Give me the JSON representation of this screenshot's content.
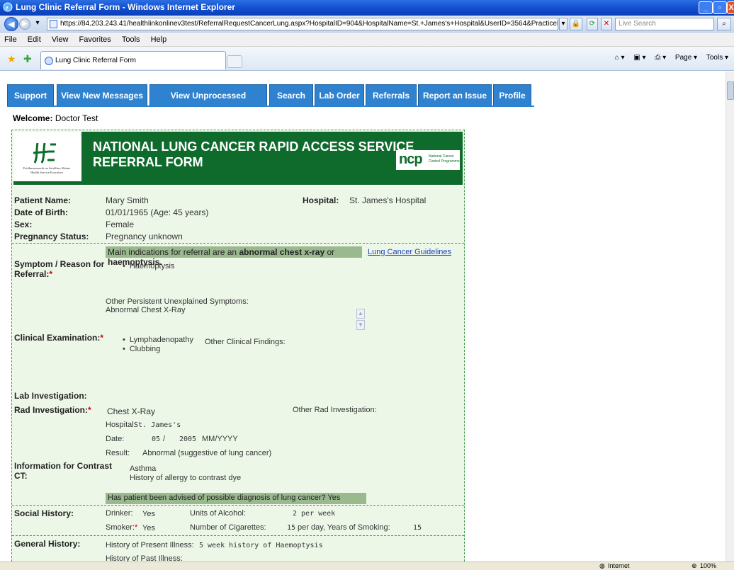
{
  "window": {
    "title": "Lung Clinic Referral Form - Windows Internet Explorer"
  },
  "browser": {
    "url": "https://84.203.243.41/healthlinkonlinev3test/ReferralRequestCancerLung.aspx?HospitalID=904&HospitalName=St.+James's+Hospital&UserID=3564&PracticeEmergencyN",
    "live_search_placeholder": "Live Search",
    "menu": [
      "File",
      "Edit",
      "View",
      "Favorites",
      "Tools",
      "Help"
    ],
    "tab_title": "Lung Clinic Referral Form",
    "commands": [
      "Page ▾",
      "Tools ▾"
    ],
    "status_zone": "Internet",
    "zoom": "100%"
  },
  "nav": [
    "Support",
    "View New Messages",
    "View Unprocessed Messages",
    "Search",
    "Lab Order",
    "Referrals",
    "Report an Issue",
    "Profile"
  ],
  "welcome": {
    "label": "Welcome:",
    "name": "Doctor Test"
  },
  "banner": {
    "title_line1": "NATIONAL LUNG CANCER RAPID ACCESS SERVICE",
    "title_line2": "REFERRAL FORM",
    "hse_text1": "Feidhmeannacht na Seirbhíse Sláinte",
    "hse_text2": "Health Service Executive",
    "ncp_logo": "ncp",
    "ncp_text1": "National Cancer",
    "ncp_text2": "Control Programme"
  },
  "patient": {
    "name_label": "Patient Name:",
    "name": "Mary Smith",
    "hospital_label": "Hospital:",
    "hospital": "St. James's Hospital",
    "dob_label": "Date of Birth:",
    "dob": "01/01/1965 (Age: 45 years)",
    "sex_label": "Sex:",
    "sex": "Female",
    "pregnancy_label": "Pregnancy Status:",
    "pregnancy": "Pregnancy unknown"
  },
  "indication": {
    "prefix": "Main indications for referral are an",
    "bold1": "abnormal chest x-ray",
    "mid": "or",
    "bold2": "haemoptysis.",
    "link": "Lung Cancer Guidelines"
  },
  "symptom": {
    "label_line1": "Symptom / Reason for",
    "label_line2": "Referral:",
    "items": [
      "Haemoptysis"
    ],
    "other_label": "Other Persistent Unexplained Symptoms:",
    "other_value": "Abnormal Chest X-Ray"
  },
  "clinical": {
    "label": "Clinical Examination:",
    "items": [
      "Lymphadenopathy",
      "Clubbing"
    ],
    "other_label": "Other Clinical Findings:"
  },
  "lab": {
    "label": "Lab Investigation:"
  },
  "rad": {
    "label": "Rad Investigation:",
    "type": "Chest X-Ray",
    "other_label": "Other Rad Investigation:",
    "hospital_label": "Hospital:",
    "hospital": "St. James's",
    "date_label": "Date:",
    "month": "05",
    "sep": "/",
    "year": "2005",
    "format": "MM/YYYY",
    "result_label": "Result:",
    "result": "Abnormal (suggestive of lung cancer)"
  },
  "contrast": {
    "label_line1": "Information for Contrast",
    "label_line2": "CT:",
    "items": [
      "Asthma",
      "History of allergy to contrast dye"
    ],
    "advised": "Has patient been advised of possible diagnosis of lung cancer? Yes"
  },
  "social": {
    "label": "Social History:",
    "drinker_label": "Drinker:",
    "drinker": "Yes",
    "alcohol_label": "Units of Alcohol:",
    "alcohol": "2 per week",
    "smoker_label": "Smoker:",
    "smoker": "Yes",
    "cigs_label": "Number of Cigarettes:",
    "cigs": "15",
    "cigs_suffix": "per day, Years of Smoking:",
    "years": "15"
  },
  "general": {
    "label": "General History:",
    "present_label": "History of Present Illness:",
    "present": "5 week history of Haemoptysis",
    "past_label": "History of Past Illness:"
  }
}
